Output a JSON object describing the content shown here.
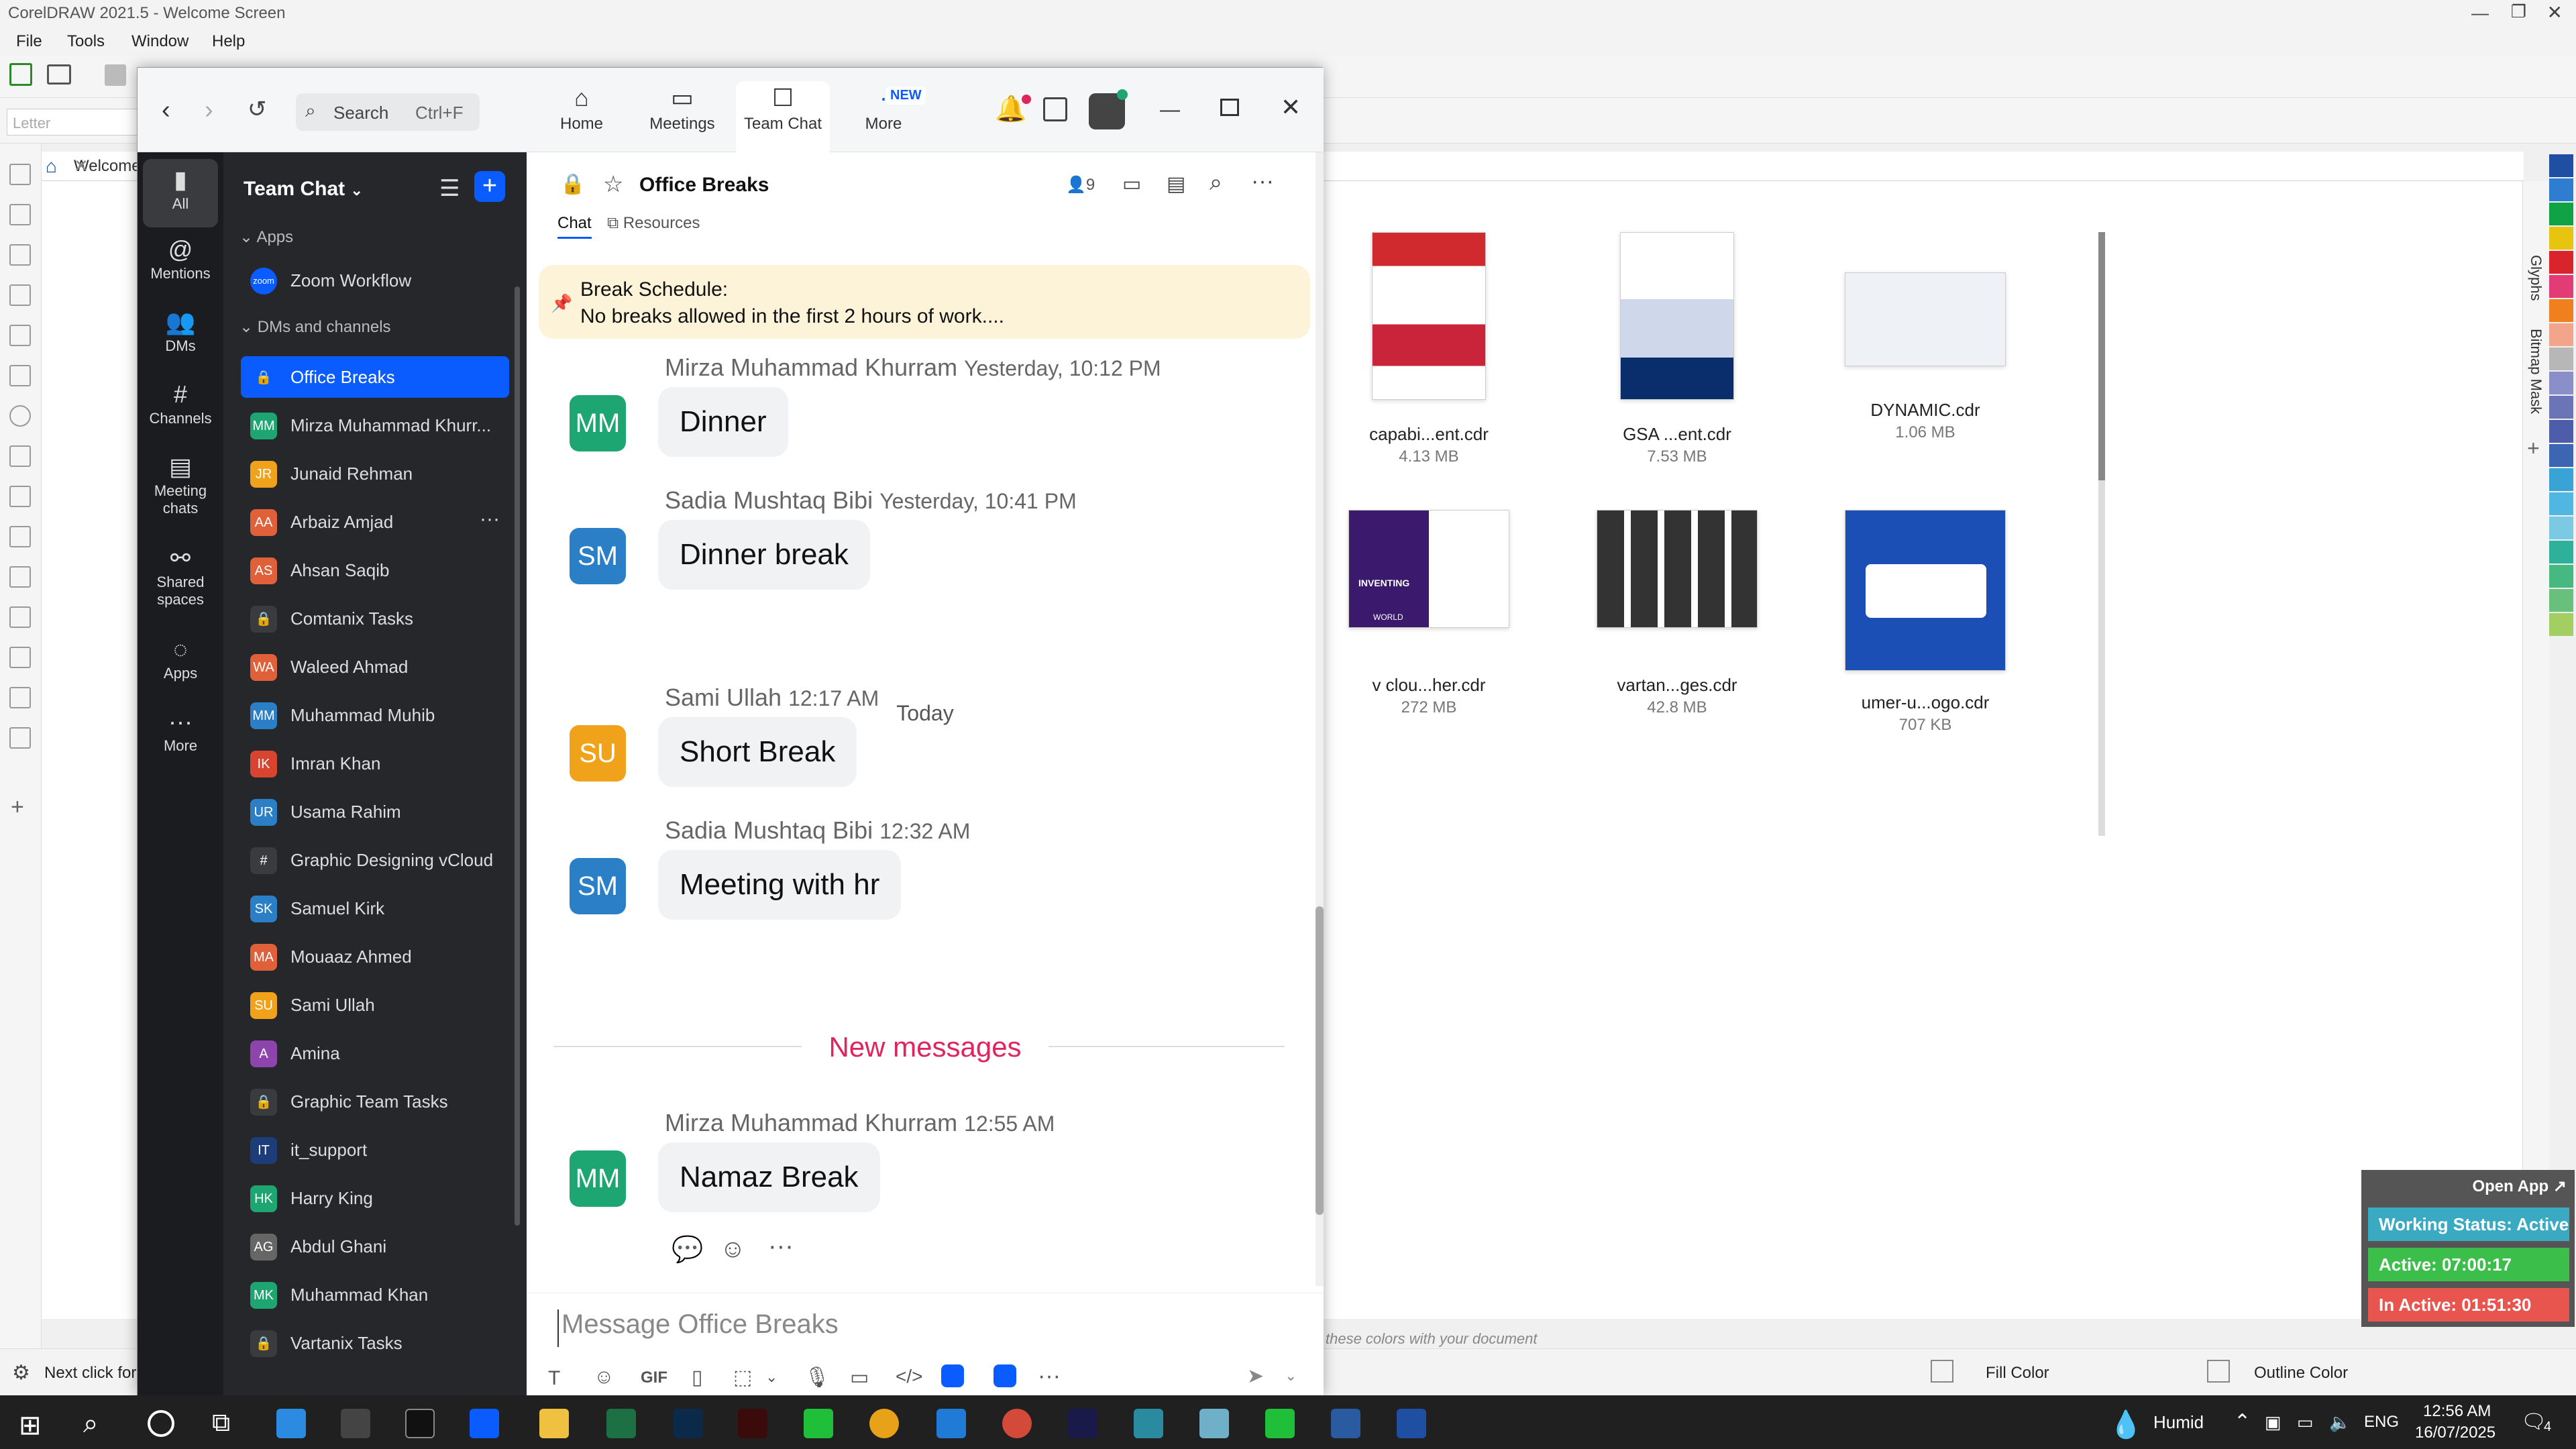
{
  "corel": {
    "title": "CorelDRAW 2021.5 - Welcome Screen",
    "menu": [
      "File",
      "Tools",
      "Window",
      "Help"
    ],
    "paper_field": "Letter",
    "welcome_tab": "Welcome",
    "files": [
      {
        "name": "capabi...ent.cdr",
        "size": "4.13 MB"
      },
      {
        "name": "GSA ...ent.cdr",
        "size": "7.53 MB"
      },
      {
        "name": "DYNAMIC.cdr",
        "size": "1.06 MB"
      },
      {
        "name": "v clou...her.cdr",
        "size": "272 MB"
      },
      {
        "name": "vartan...ges.cdr",
        "size": "42.8 MB"
      },
      {
        "name": "umer-u...ogo.cdr",
        "size": "707 KB"
      }
    ],
    "thumb_texts": {
      "inventing": "INVENTING",
      "world": "WORLD"
    },
    "dock_tabs": [
      "Glyphs",
      "Bitmap Mask"
    ],
    "status": {
      "hint": "Next click for D",
      "colors_hint": "these colors with your document",
      "fill": "Fill Color",
      "outline": "Outline Color"
    },
    "palette": [
      "#1f4fa3",
      "#2f7dd1",
      "#10a346",
      "#e6c40f",
      "#d9242c",
      "#e23b75",
      "#f07f1d",
      "#f2a58b",
      "#b7b7b7",
      "#8a8fc9",
      "#6c74b8",
      "#4e5da9",
      "#3c66b1",
      "#3aa3d6",
      "#50b6e2",
      "#7cc9e4",
      "#2db19a",
      "#45b97f",
      "#68c07d",
      "#a3cf62"
    ]
  },
  "widget": {
    "open": "Open App",
    "status": "Working Status: Active",
    "active": "Active: 07:00:17",
    "inactive": "In Active: 01:51:30"
  },
  "zoom": {
    "search": "Search",
    "shortcut": "Ctrl+F",
    "tabs": [
      {
        "label": "Home"
      },
      {
        "label": "Meetings"
      },
      {
        "label": "Team Chat"
      },
      {
        "label": "More",
        "badge": "NEW"
      }
    ],
    "rail": [
      {
        "label": "All"
      },
      {
        "label": "Mentions"
      },
      {
        "label": "DMs"
      },
      {
        "label": "Channels"
      },
      {
        "label": "Meeting chats"
      },
      {
        "label": "Shared spaces"
      },
      {
        "label": "Apps"
      },
      {
        "label": "More"
      }
    ],
    "sidebar": {
      "title": "Team Chat",
      "sections": [
        "Apps",
        "DMs and channels"
      ],
      "apps": [
        {
          "label": "Zoom Workflow",
          "initials": "zoom",
          "color": "#0b5cff"
        }
      ],
      "items": [
        {
          "label": "Office Breaks",
          "initials": "",
          "color": "#0b5cff"
        },
        {
          "label": "Mirza Muhammad Khurr...",
          "initials": "MM",
          "color": "#1ea672"
        },
        {
          "label": "Junaid Rehman",
          "initials": "JR",
          "color": "#f0a21a"
        },
        {
          "label": "Arbaiz Amjad",
          "initials": "AA",
          "color": "#e0603a"
        },
        {
          "label": "Ahsan Saqib",
          "initials": "AS",
          "color": "#e0603a"
        },
        {
          "label": "Comtanix Tasks",
          "initials": "",
          "color": "#3a3b3f"
        },
        {
          "label": "Waleed Ahmad",
          "initials": "WA",
          "color": "#e0603a"
        },
        {
          "label": "Muhammad Muhib",
          "initials": "MM",
          "color": "#2a7fc7"
        },
        {
          "label": "Imran Khan",
          "initials": "IK",
          "color": "#d8442f"
        },
        {
          "label": "Usama Rahim",
          "initials": "UR",
          "color": "#2a7fc7"
        },
        {
          "label": "Graphic Designing vCloud",
          "initials": "#",
          "color": "#3a3b3f"
        },
        {
          "label": "Samuel Kirk",
          "initials": "SK",
          "color": "#2a7fc7"
        },
        {
          "label": "Mouaaz Ahmed",
          "initials": "MA",
          "color": "#e0603a"
        },
        {
          "label": "Sami Ullah",
          "initials": "SU",
          "color": "#f0a21a"
        },
        {
          "label": "Amina",
          "initials": "A",
          "color": "#8e44ad"
        },
        {
          "label": "Graphic Team Tasks",
          "initials": "",
          "color": "#3a3b3f"
        },
        {
          "label": "it_support",
          "initials": "IT",
          "color": "#1c3d7a"
        },
        {
          "label": "Harry King",
          "initials": "HK",
          "color": "#1ea672"
        },
        {
          "label": "Abdul Ghani",
          "initials": "AG",
          "color": "#666666"
        },
        {
          "label": "Muhammad Khan",
          "initials": "MK",
          "color": "#1ea672"
        },
        {
          "label": "Vartanix Tasks",
          "initials": "",
          "color": "#3a3b3f"
        }
      ]
    },
    "channel": {
      "name": "Office Breaks",
      "members": "9",
      "tabs": [
        "Chat",
        "Resources"
      ],
      "pinned_title": "Break Schedule:",
      "pinned_text": "No breaks allowed in the first 2 hours of work...."
    },
    "messages": [
      {
        "initials": "MM",
        "color": "#1ea672",
        "sender": "Mirza Muhammad Khurram",
        "time": "Yesterday, 10:12 PM",
        "text": "Dinner"
      },
      {
        "initials": "SM",
        "color": "#2a7fc7",
        "sender": "Sadia Mushtaq Bibi",
        "time": "Yesterday, 10:41 PM",
        "text": "Dinner break"
      },
      {
        "initials": "SU",
        "color": "#f0a21a",
        "sender": "Sami Ullah",
        "time": "12:17 AM",
        "text": "Short Break"
      },
      {
        "initials": "SM",
        "color": "#2a7fc7",
        "sender": "Sadia Mushtaq Bibi",
        "time": "12:32 AM",
        "text": "Meeting with hr"
      },
      {
        "initials": "MM",
        "color": "#1ea672",
        "sender": "Mirza Muhammad Khurram",
        "time": "12:55 AM",
        "text": "Namaz Break"
      }
    ],
    "divider_today": "Today",
    "divider_new": "New messages",
    "composer_placeholder": "Message Office Breaks",
    "gif": "GIF"
  },
  "taskbar": {
    "weather": "Humid",
    "lang": "ENG",
    "time": "12:56 AM",
    "date": "16/07/2025",
    "notif": "4"
  }
}
